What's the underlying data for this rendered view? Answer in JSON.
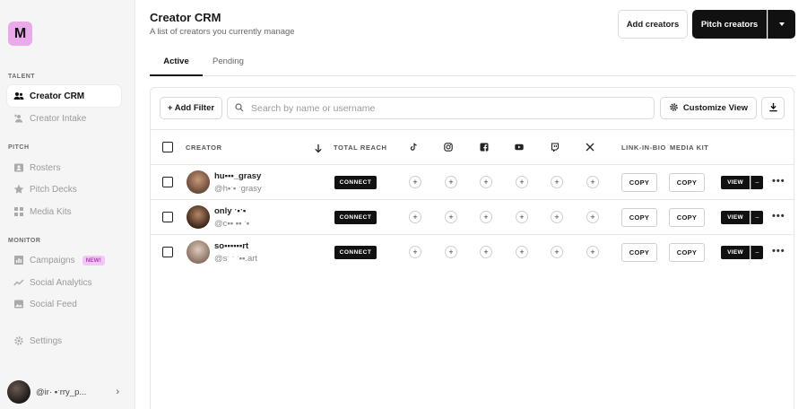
{
  "brand": {
    "logo_letter": "M",
    "logo_color": "#e9a9ea"
  },
  "sidebar": {
    "sections": [
      {
        "label": "TALENT"
      },
      {
        "label": "PITCH"
      },
      {
        "label": "MONITOR"
      }
    ],
    "items": [
      {
        "label": "Creator CRM",
        "icon": "users-icon",
        "active": true
      },
      {
        "label": "Creator Intake",
        "icon": "user-plus-icon"
      },
      {
        "label": "Rosters",
        "icon": "contact-card-icon"
      },
      {
        "label": "Pitch Decks",
        "icon": "star-icon"
      },
      {
        "label": "Media Kits",
        "icon": "grid-icon"
      },
      {
        "label": "Campaigns",
        "icon": "bar-chart-icon",
        "badge": "NEW!"
      },
      {
        "label": "Social Analytics",
        "icon": "trend-line-icon"
      },
      {
        "label": "Social Feed",
        "icon": "image-icon"
      },
      {
        "label": "Settings",
        "icon": "gear-icon"
      }
    ],
    "user": {
      "handle": "@ir· ▪ˑrry_p..."
    }
  },
  "header": {
    "title": "Creator CRM",
    "subtitle": "A list of creators you currently manage",
    "add_button": "Add creators",
    "pitch_button": "Pitch creators"
  },
  "tabs": [
    {
      "label": "Active",
      "active": true
    },
    {
      "label": "Pending"
    }
  ],
  "toolbar": {
    "add_filter": "+ Add Filter",
    "search_placeholder": "Search by name or username",
    "customize_view": "Customize View"
  },
  "table": {
    "columns": {
      "creator": "CREATOR",
      "total_reach": "TOTAL REACH",
      "social_icons": [
        "tiktok-icon",
        "instagram-icon",
        "facebook-icon",
        "youtube-icon",
        "twitch-icon",
        "x-icon"
      ],
      "link_in_bio": "LINK-IN-BIO",
      "media_kit": "MEDIA KIT"
    },
    "rows": [
      {
        "name": "hu▪▪▪_grasy",
        "handle": "@h▪ˑ▪ ˑgrasy",
        "connect": "CONNECT",
        "copy1": "COPY",
        "copy2": "COPY",
        "view": "VIEW",
        "avatar_color": "#8c6a55"
      },
      {
        "name": "only ˑ▪ˑ▪",
        "handle": "@c▪▪ ▪▪ ˑ▪",
        "connect": "CONNECT",
        "copy1": "COPY",
        "copy2": "COPY",
        "view": "VIEW",
        "avatar_color": "#5a3a2c"
      },
      {
        "name": "so▪▪▪▪▪▪rt",
        "handle": "@sˑ ˑ ˑ▪▪.art",
        "connect": "CONNECT",
        "copy1": "COPY",
        "copy2": "COPY",
        "view": "VIEW",
        "avatar_color": "#b8a294"
      }
    ]
  }
}
